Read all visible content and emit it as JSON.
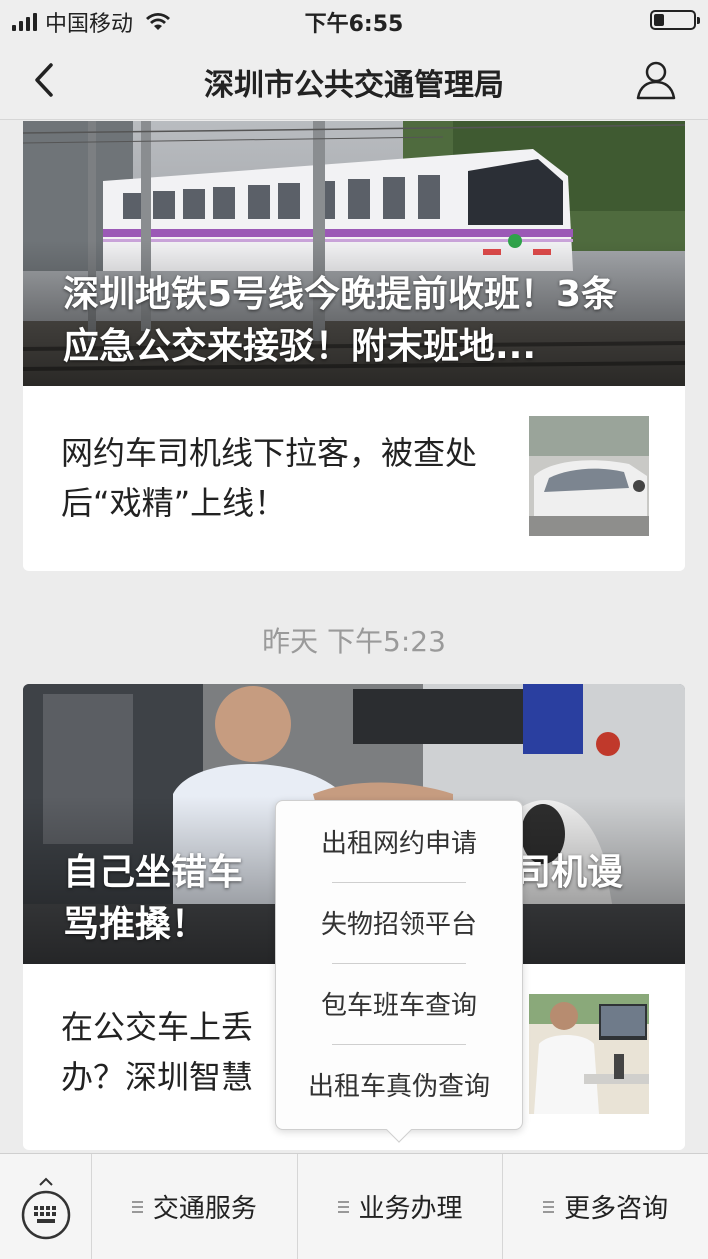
{
  "status_bar": {
    "carrier": "中国移动",
    "time": "下午6:55",
    "battery_level": 0.25
  },
  "nav": {
    "title": "深圳市公共交通管理局",
    "back_icon": "chevron-left-icon",
    "profile_icon": "user-icon"
  },
  "feed": {
    "card1": {
      "hero_title": "深圳地铁5号线今晚提前收班！3条应急公交来接驳！附末班地...",
      "sub_title": "网约车司机线下拉客，被查处后“戏精”上线！"
    },
    "timestamp": "昨天 下午5:23",
    "card2": {
      "hero_title": "自己坐错车竟对司机谩骂推搡！",
      "hero_title_left": "自己坐错车",
      "hero_title_right": "司机谩",
      "hero_title_line2": "骂推搡！",
      "sub_title": "在公交车上丢了东西怎么办？深圳智慧",
      "sub_title_line1": "在公交车上丢",
      "sub_title_line2": "办？深圳智慧"
    }
  },
  "popup_menu": {
    "items": [
      "出租网约申请",
      "失物招领平台",
      "包车班车查询",
      "出租车真伪查询"
    ]
  },
  "bottom_menu": {
    "keyboard_icon": "keyboard-icon",
    "items": [
      "交通服务",
      "业务办理",
      "更多咨询"
    ]
  },
  "colors": {
    "metro_stripe": "#9b59b6",
    "metro_body": "#f2f2f4"
  }
}
